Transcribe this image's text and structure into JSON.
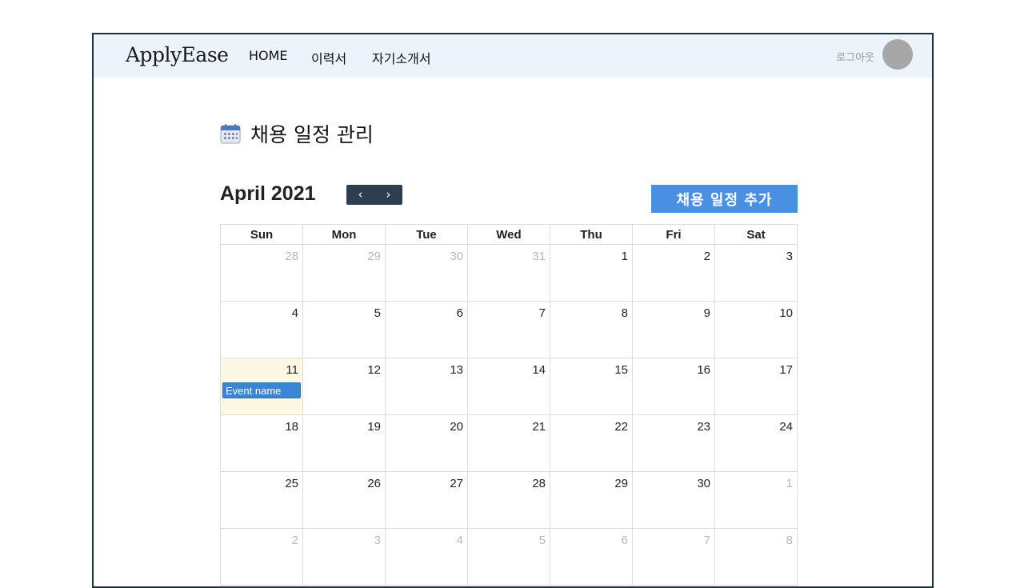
{
  "navbar": {
    "brand": "ApplyEase",
    "links": [
      "HOME",
      "이력서",
      "자기소개서"
    ],
    "logout_label": "로그아웃"
  },
  "page": {
    "title": "채용 일정 관리",
    "title_icon": "calendar-icon"
  },
  "calendar": {
    "month_title": "April 2021",
    "prev_label": "‹",
    "next_label": "›",
    "add_button_label": "채용 일정 추가",
    "weekdays": [
      "Sun",
      "Mon",
      "Tue",
      "Wed",
      "Thu",
      "Fri",
      "Sat"
    ],
    "weeks": [
      [
        {
          "d": "28",
          "o": true
        },
        {
          "d": "29",
          "o": true
        },
        {
          "d": "30",
          "o": true
        },
        {
          "d": "31",
          "o": true
        },
        {
          "d": "1"
        },
        {
          "d": "2"
        },
        {
          "d": "3"
        }
      ],
      [
        {
          "d": "4"
        },
        {
          "d": "5"
        },
        {
          "d": "6"
        },
        {
          "d": "7"
        },
        {
          "d": "8"
        },
        {
          "d": "9"
        },
        {
          "d": "10"
        }
      ],
      [
        {
          "d": "11",
          "today": true,
          "event": "Event name"
        },
        {
          "d": "12"
        },
        {
          "d": "13"
        },
        {
          "d": "14"
        },
        {
          "d": "15"
        },
        {
          "d": "16"
        },
        {
          "d": "17"
        }
      ],
      [
        {
          "d": "18"
        },
        {
          "d": "19"
        },
        {
          "d": "20"
        },
        {
          "d": "21"
        },
        {
          "d": "22"
        },
        {
          "d": "23"
        },
        {
          "d": "24"
        }
      ],
      [
        {
          "d": "25"
        },
        {
          "d": "26"
        },
        {
          "d": "27"
        },
        {
          "d": "28"
        },
        {
          "d": "29"
        },
        {
          "d": "30"
        },
        {
          "d": "1",
          "o": true
        }
      ],
      [
        {
          "d": "2",
          "o": true
        },
        {
          "d": "3",
          "o": true
        },
        {
          "d": "4",
          "o": true
        },
        {
          "d": "5",
          "o": true
        },
        {
          "d": "6",
          "o": true
        },
        {
          "d": "7",
          "o": true
        },
        {
          "d": "8",
          "o": true
        }
      ]
    ],
    "colors": {
      "nav_group_bg": "#2c3e50",
      "add_button_bg": "#4a90e2",
      "today_bg": "#fcf8e3",
      "event_bg": "#3b86d4"
    }
  }
}
